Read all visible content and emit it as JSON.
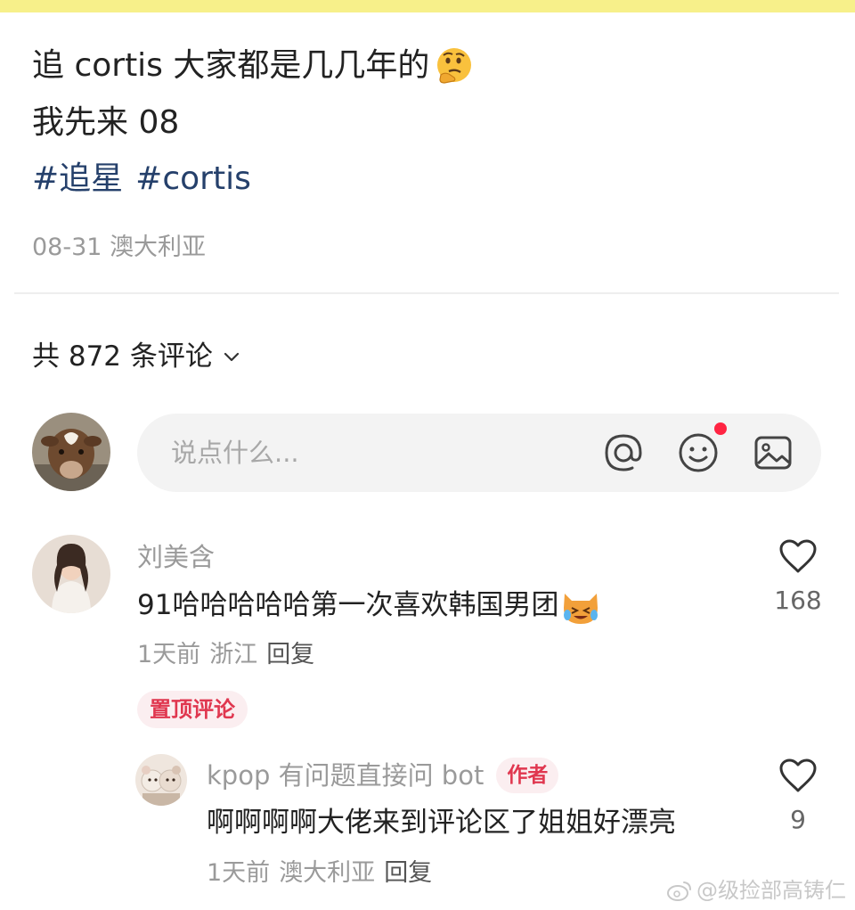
{
  "post": {
    "title": "追 cortis 大家都是几几年的",
    "emoji": "thinking-face-icon",
    "line2": "我先来 08",
    "tags": [
      "#追星",
      "#cortis"
    ],
    "date": "08-31",
    "location": "澳大利亚"
  },
  "comments_header": {
    "count_label": "共 872 条评论"
  },
  "input": {
    "placeholder": "说点什么...",
    "icons": [
      "at-icon",
      "emoji-icon",
      "image-icon"
    ],
    "notification_dot_color": "#ff2442"
  },
  "comments": [
    {
      "username": "刘美含",
      "text": "91哈哈哈哈哈第一次喜欢韩国男团",
      "emoji": "crying-laughing-cat-icon",
      "time": "1天前",
      "location": "浙江",
      "reply_label": "回复",
      "pinned_label": "置顶评论",
      "likes": "168"
    }
  ],
  "replies": [
    {
      "username": "kpop 有问题直接问 bot",
      "badge": "作者",
      "text": "啊啊啊啊大佬来到评论区了姐姐好漂亮",
      "time": "1天前",
      "location": "澳大利亚",
      "reply_label": "回复",
      "likes": "9"
    }
  ],
  "watermark": {
    "text": "@级捡部高铸仁"
  },
  "colors": {
    "top_strip": "#f7f08a",
    "hashtag": "#25406b",
    "badge_text": "#e0374f",
    "badge_bg": "#fbeef0",
    "muted_text": "#9a9a9a"
  }
}
